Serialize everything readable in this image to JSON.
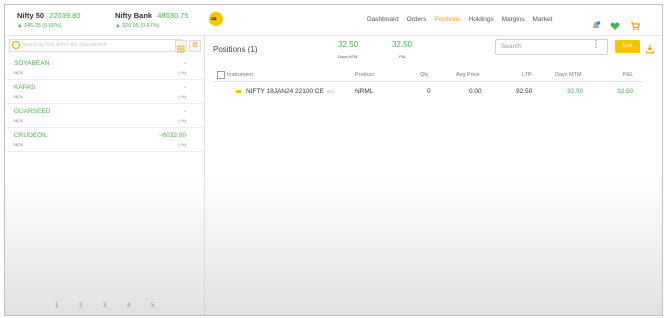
{
  "header": {
    "indices": [
      {
        "name": "Nifty 50",
        "value": "22039.80",
        "change": "145.35 (0.66%)"
      },
      {
        "name": "Nifty Bank",
        "value": "48030.75",
        "change": "320.95 (0.67%)"
      }
    ],
    "logo_glyph": "∞",
    "nav": [
      "Dashboard",
      "Orders",
      "Positions",
      "Holdings",
      "Margins",
      "Market"
    ],
    "active_nav": "Positions",
    "notification_count": "0"
  },
  "watchlist": {
    "search_placeholder": "Search eg:TCS, NIFTY BO, GOLDM MAR",
    "items": [
      {
        "name": "SOYABEAN",
        "exchange": "MCX",
        "price": "-",
        "pct": "( %)"
      },
      {
        "name": "KAPAS",
        "exchange": "MCX",
        "price": "-",
        "pct": "( %)"
      },
      {
        "name": "GUARSEED",
        "exchange": "MCX",
        "price": "-",
        "pct": "( %)"
      },
      {
        "name": "CRUDEOIL",
        "exchange": "MCX",
        "price": "~6032.00",
        "pct": "( %)"
      }
    ],
    "pages": [
      "1",
      "2",
      "3",
      "4",
      "5"
    ]
  },
  "positions": {
    "title": "Positions",
    "count": "(1)",
    "days_mtm_value": "32.50",
    "days_mtm_label": "Days MTM",
    "pnl_value": "32.50",
    "pnl_label": "P&L",
    "search_placeholder": "Search",
    "exit_label": "Exit",
    "columns": [
      "Instrument",
      "Product",
      "Qty",
      "Avg Price",
      "LTP",
      "Days MTM",
      "P&L"
    ],
    "rows": [
      {
        "instrument": "NIFTY 18JAN24 22100 CE",
        "exchange": "NFO",
        "product": "NRML",
        "qty": "0",
        "avg_price": "0.00",
        "ltp": "92.50",
        "days_mtm": "32.50",
        "pnl": "32.50"
      }
    ]
  },
  "colors": {
    "accent": "#f3c400",
    "positive": "#4caf50",
    "active_nav": "#ff9800"
  }
}
